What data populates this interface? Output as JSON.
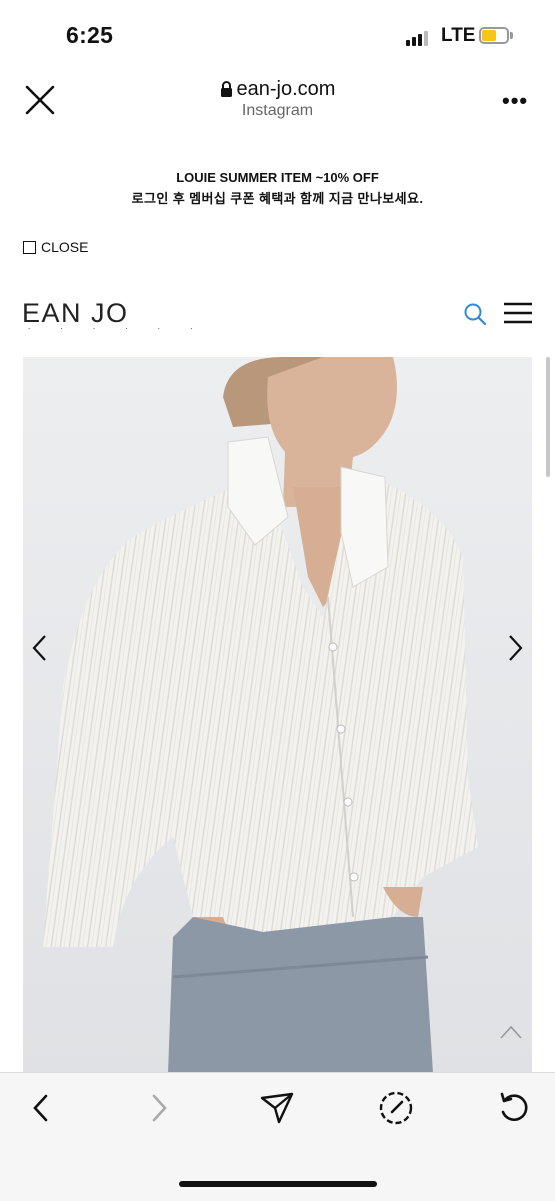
{
  "status_bar": {
    "time": "6:25",
    "network": "LTE"
  },
  "browser": {
    "url": "ean-jo.com",
    "subtitle": "Instagram",
    "close_icon": "close-icon",
    "more_icon": "more-icon",
    "more_label": "•••"
  },
  "promo": {
    "headline": "LOUIE SUMMER ITEM ~10% OFF",
    "subline": "로그인 후 멤버십 쿠폰 혜택과 함께 지금 만나보세요.",
    "close_label": "CLOSE"
  },
  "site": {
    "logo": "EAN JO",
    "logo_dots": ". . . . . .",
    "search_icon": "search-icon",
    "menu_icon": "hamburger-menu-icon"
  },
  "product_image": {
    "description_icon": "photo",
    "prev_icon": "chevron-left-icon",
    "next_icon": "chevron-right-icon",
    "scroll_top_icon": "chevron-up-icon"
  },
  "bottom_nav": {
    "back_icon": "back-arrow-icon",
    "forward_icon": "forward-arrow-icon",
    "share_icon": "send-icon",
    "compass_icon": "compass-icon",
    "reload_icon": "reload-icon"
  },
  "colors": {
    "accent": "#2f8ad8",
    "battery": "#f5c518"
  }
}
